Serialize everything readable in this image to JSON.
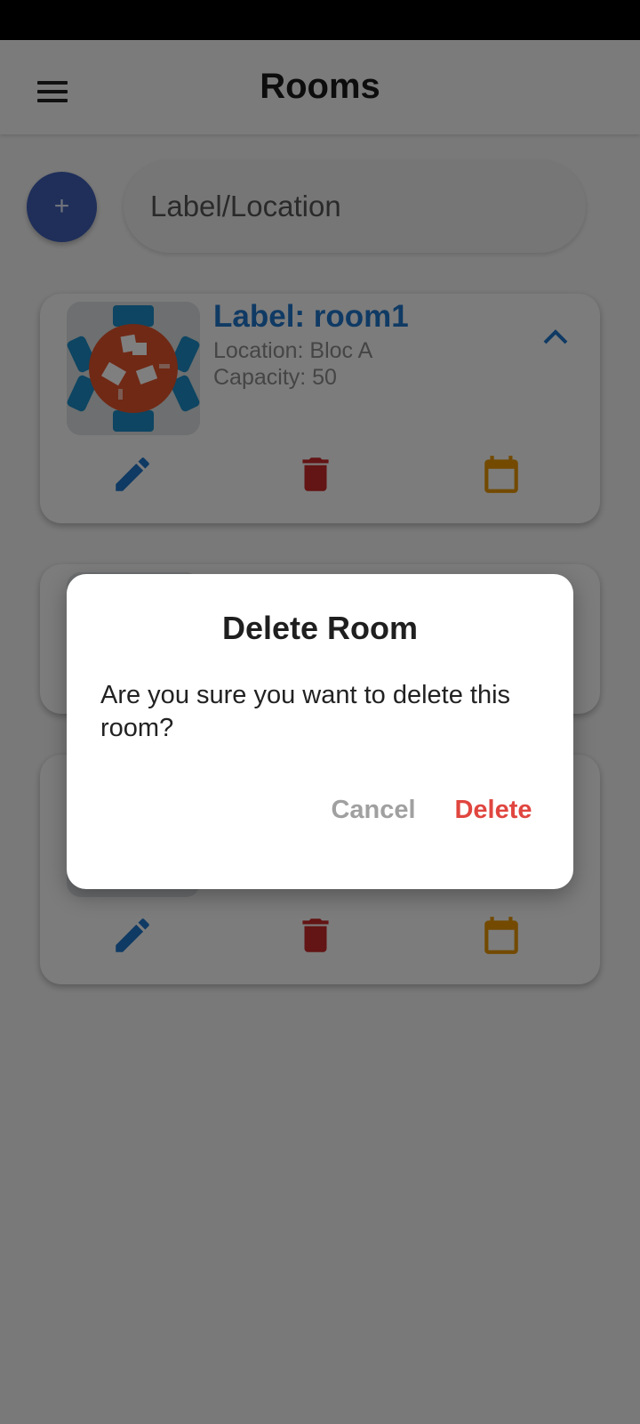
{
  "app_bar": {
    "title": "Rooms",
    "menu_icon": "menu-icon"
  },
  "add_button": {
    "label": "+"
  },
  "search": {
    "placeholder": "Label/Location",
    "value": ""
  },
  "rooms": [
    {
      "label": "Label: room1",
      "location": "Location: Bloc A",
      "capacity": "Capacity: 50",
      "expanded": true
    },
    {
      "label": "",
      "location": "",
      "capacity": "",
      "expanded": false
    },
    {
      "label": "",
      "location": "",
      "capacity": "",
      "expanded": true
    }
  ],
  "card_actions": {
    "edit_icon": "edit-icon",
    "delete_icon": "trash-icon",
    "calendar_icon": "calendar-icon"
  },
  "dialog": {
    "title": "Delete Room",
    "message": "Are you sure you want to delete this room?",
    "cancel_label": "Cancel",
    "delete_label": "Delete"
  },
  "colors": {
    "primary": "#1e74c8",
    "fab": "#3f5fb5",
    "delete": "#c62828",
    "calendar": "#e69500",
    "dialog_delete": "#e0463f",
    "dialog_cancel": "#a0a0a0"
  }
}
